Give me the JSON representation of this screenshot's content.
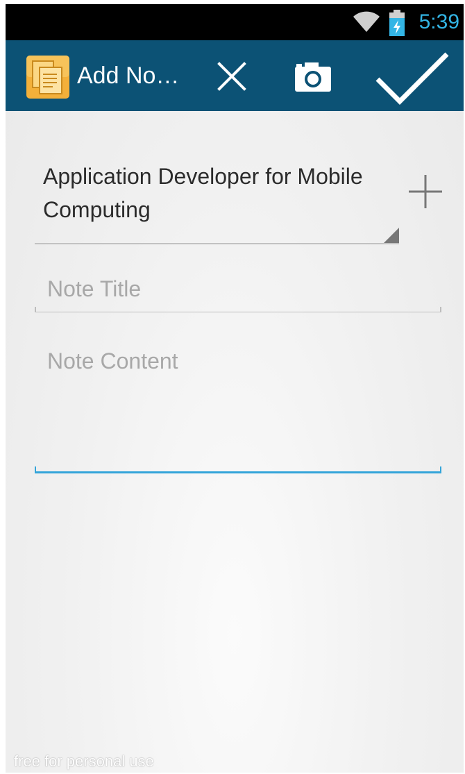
{
  "status_bar": {
    "time": "5:39",
    "icons": [
      "wifi-icon",
      "battery-charging-icon"
    ],
    "accent_color": "#33b5e5"
  },
  "action_bar": {
    "title": "Add No…",
    "background_color": "#0c5275",
    "app_icon": "notes-app-icon",
    "actions": [
      "close-icon",
      "camera-icon",
      "checkmark-icon"
    ]
  },
  "form": {
    "course_spinner": {
      "selected": "Application Developer for Mobile Computing"
    },
    "add_course_button": "plus-icon",
    "note_title": {
      "placeholder": "Note Title",
      "value": ""
    },
    "note_content": {
      "placeholder": "Note Content",
      "value": ""
    },
    "focus_color": "#33a4d9"
  },
  "watermark": "free for personal use"
}
